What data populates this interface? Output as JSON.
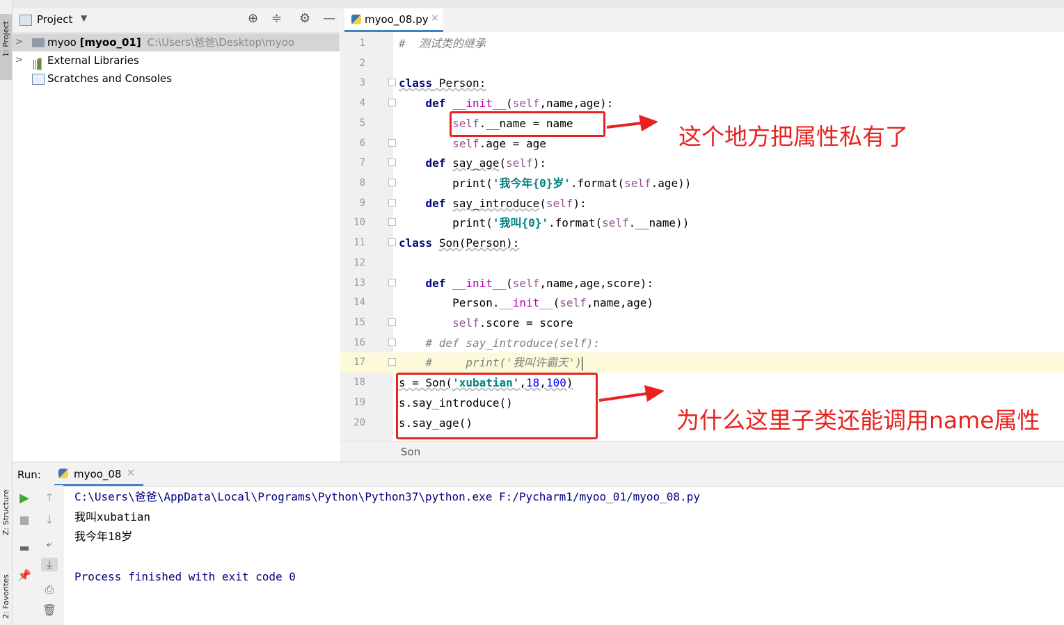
{
  "left_strip": {
    "project_tab": "1: Project",
    "structure_tab": "Z: Structure",
    "favorites_tab": "2: Favorites"
  },
  "project": {
    "title": "Project",
    "tree": [
      {
        "name": "myoo",
        "module": "[myoo_01]",
        "path": "C:\\Users\\爸爸\\Desktop\\myoo"
      },
      {
        "name": "External Libraries"
      },
      {
        "name": "Scratches and Consoles"
      }
    ]
  },
  "editor": {
    "tab_label": "myoo_08.py",
    "line_numbers": [
      "1",
      "2",
      "3",
      "4",
      "5",
      "6",
      "7",
      "8",
      "9",
      "10",
      "11",
      "12",
      "13",
      "14",
      "15",
      "16",
      "17",
      "18",
      "19",
      "20"
    ],
    "breadcrumb": "Son"
  },
  "annotations": {
    "top": "这个地方把属性私有了",
    "bottom": "为什么这里子类还能调用name属性"
  },
  "run": {
    "label": "Run:",
    "tab": "myoo_08",
    "output": [
      "C:\\Users\\爸爸\\AppData\\Local\\Programs\\Python\\Python37\\python.exe F:/Pycharm1/myoo_01/myoo_08.py",
      "我叫xubatian",
      "我今年18岁",
      "",
      "Process finished with exit code 0"
    ]
  },
  "colors": {
    "annotation": "#e8231f",
    "keyword": "#000080",
    "self": "#94558d",
    "string": "#008080",
    "number": "#0000ff",
    "console": "#000080"
  }
}
